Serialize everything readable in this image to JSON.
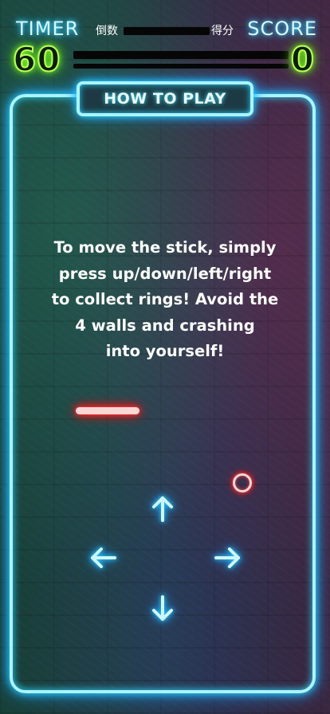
{
  "hud": {
    "timer_label": "TIMER",
    "timer_sub": "倒数",
    "timer_value": "60",
    "score_label": "SCORE",
    "score_sub": "得分",
    "score_value": "0"
  },
  "panel": {
    "title": "HOW TO PLAY",
    "instructions": [
      "To move the stick, simply",
      "press up/down/left/right",
      "to collect rings! Avoid the",
      "4 walls and crashing",
      "into yourself!"
    ]
  },
  "controls": {
    "up": "arrow-up-icon",
    "down": "arrow-down-icon",
    "left": "arrow-left-icon",
    "right": "arrow-right-icon"
  },
  "colors": {
    "neon_blue": "#29d6ff",
    "neon_green": "#8cff2a",
    "neon_red": "#ff2020"
  }
}
